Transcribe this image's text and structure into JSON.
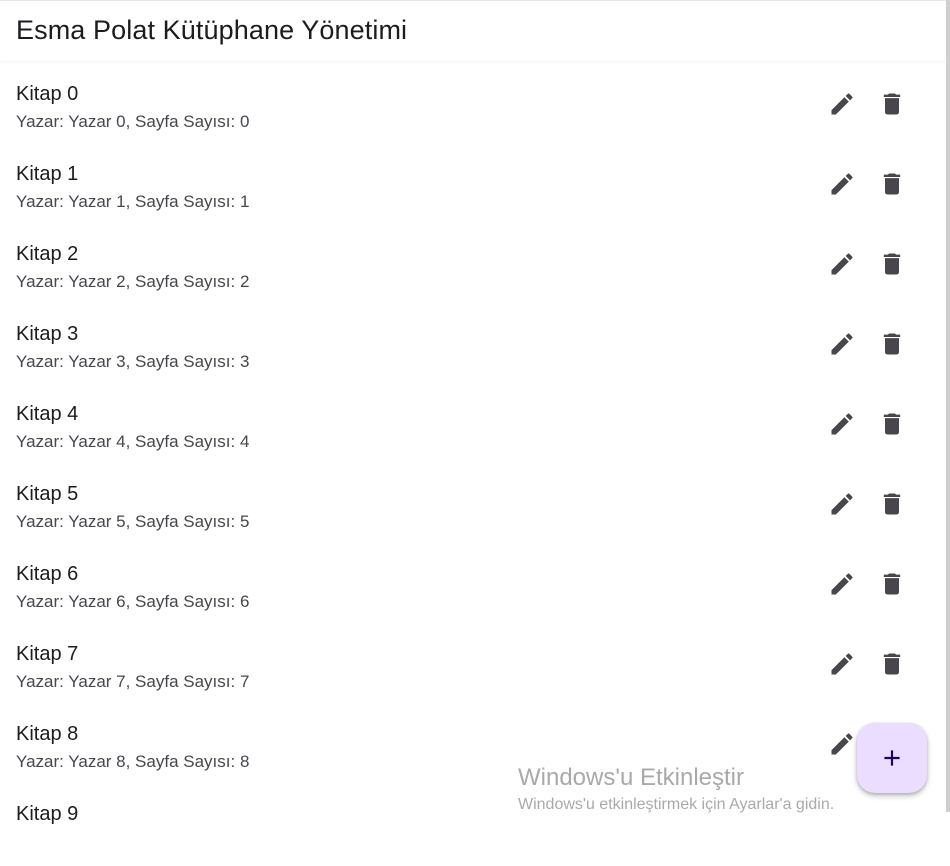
{
  "app_bar": {
    "title": "Esma Polat Kütüphane Yönetimi"
  },
  "books": [
    {
      "title": "Kitap 0",
      "subtitle": "Yazar: Yazar 0, Sayfa Sayısı: 0"
    },
    {
      "title": "Kitap 1",
      "subtitle": "Yazar: Yazar 1, Sayfa Sayısı: 1"
    },
    {
      "title": "Kitap 2",
      "subtitle": "Yazar: Yazar 2, Sayfa Sayısı: 2"
    },
    {
      "title": "Kitap 3",
      "subtitle": "Yazar: Yazar 3, Sayfa Sayısı: 3"
    },
    {
      "title": "Kitap 4",
      "subtitle": "Yazar: Yazar 4, Sayfa Sayısı: 4"
    },
    {
      "title": "Kitap 5",
      "subtitle": "Yazar: Yazar 5, Sayfa Sayısı: 5"
    },
    {
      "title": "Kitap 6",
      "subtitle": "Yazar: Yazar 6, Sayfa Sayısı: 6"
    },
    {
      "title": "Kitap 7",
      "subtitle": "Yazar: Yazar 7, Sayfa Sayısı: 7"
    },
    {
      "title": "Kitap 8",
      "subtitle": "Yazar: Yazar 8, Sayfa Sayısı: 8"
    },
    {
      "title": "Kitap 9",
      "subtitle": ""
    }
  ],
  "icons": {
    "edit": "edit-icon",
    "delete": "delete-icon",
    "add": "add-icon"
  },
  "fab": {
    "icon": "add-icon"
  },
  "watermark": {
    "title": "Windows'u Etkinleştir",
    "subtitle": "Windows'u etkinleştirmek için Ayarlar'a gidin."
  },
  "colors": {
    "fab_background": "#eaddff",
    "fab_icon": "#21005d",
    "icon": "#49454f",
    "title_text": "#1d1b20",
    "subtitle_text": "#49454f"
  }
}
